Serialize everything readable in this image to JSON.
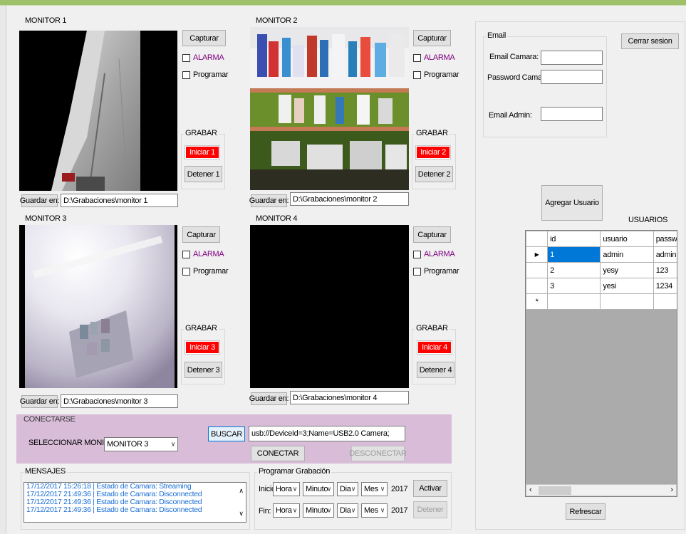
{
  "monitors": [
    {
      "title": "MONITOR 1",
      "capture": "Capturar",
      "alarm": "ALARMA",
      "schedule": "Programar",
      "record_group": "GRABAR",
      "start": "Iniciar 1",
      "stop": "Detener 1",
      "save_label": "Guardar en:",
      "path": "D:\\Grabaciones\\monitor 1"
    },
    {
      "title": "MONITOR 2",
      "capture": "Capturar",
      "alarm": "ALARMA",
      "schedule": "Programar",
      "record_group": "GRABAR",
      "start": "Iniciar 2",
      "stop": "Detener 2",
      "save_label": "Guardar en:",
      "path": "D:\\Grabaciones\\monitor 2"
    },
    {
      "title": "MONITOR 3",
      "capture": "Capturar",
      "alarm": "ALARMA",
      "schedule": "Programar",
      "record_group": "GRABAR",
      "start": "Iniciar 3",
      "stop": "Detener 3",
      "save_label": "Guardar en:",
      "path": "D:\\Grabaciones\\monitor 3"
    },
    {
      "title": "MONITOR 4",
      "capture": "Capturar",
      "alarm": "ALARMA",
      "schedule": "Programar",
      "record_group": "GRABAR",
      "start": "Iniciar 4",
      "stop": "Detener 4",
      "save_label": "Guardar en:",
      "path": "D:\\Grabaciones\\monitor 4"
    }
  ],
  "connect": {
    "title": "CONECTARSE",
    "select_label": "SELECCIONAR MONITOR:",
    "select_value": "MONITOR 3",
    "search_button": "BUSCAR",
    "device": "usb://DeviceId=3;Name=USB2.0 Camera;",
    "connect_button": "CONECTAR",
    "disconnect_button": "DESCONECTAR",
    "accent": "#d8bcd8"
  },
  "messages": {
    "title": "MENSAJES",
    "lines": [
      "17/12/2017 15:26:18 | Estado de Camara: Streaming",
      "17/12/2017 21:49:36 | Estado de Camara: Disconnected",
      "17/12/2017 21:49:36 | Estado de Camara: Disconnected",
      "17/12/2017 21:49:36 | Estado de Camara: Disconnected"
    ]
  },
  "schedule": {
    "title": "Programar Grabación",
    "start_label": "Inicio:",
    "end_label": "Fin:",
    "hour": "Hora",
    "minute": "Minuto",
    "day": "Dia",
    "month": "Mes",
    "year": "2017",
    "activate_button": "Activar",
    "stop_button": "Detener"
  },
  "email": {
    "title": "Email",
    "camera_label": "Email Camara:",
    "password_label": "Password Camara:",
    "admin_label": "Email Admin:",
    "camera_value": "",
    "password_value": "",
    "admin_value": ""
  },
  "logout_button": "Cerrar sesion",
  "add_user_button": "Agregar Usuario",
  "users": {
    "title": "USUARIOS",
    "columns": [
      "id",
      "usuario",
      "passw"
    ],
    "rows": [
      {
        "id": "1",
        "usuario": "admin",
        "password": "admin"
      },
      {
        "id": "2",
        "usuario": "yesy",
        "password": "123"
      },
      {
        "id": "3",
        "usuario": "yesi",
        "password": "1234"
      }
    ],
    "new_row_marker": "*",
    "current_row_marker": "▶"
  },
  "refresh_button": "Refrescar",
  "colors": {
    "record_red": "#ff0000",
    "alarm_purple": "#800080",
    "message_blue": "#1a6fd6",
    "selection_blue": "#0078d7"
  }
}
